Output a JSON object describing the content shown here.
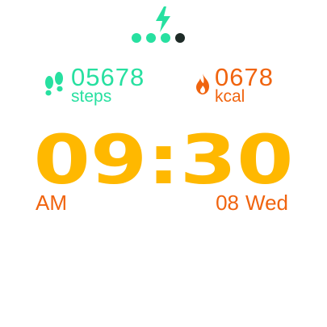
{
  "colors": {
    "accent_green": "#27e0a0",
    "accent_orange": "#f0640f",
    "time_yellow": "#ffb800",
    "background": "#ffffff",
    "dot_inactive": "#1e2b27"
  },
  "battery": {
    "icon": "charging-bolt-icon",
    "level_filled": 3,
    "level_total": 4
  },
  "steps": {
    "icon": "footprints-icon",
    "value": "05678",
    "unit": "steps"
  },
  "calories": {
    "icon": "flame-icon",
    "value": "0678",
    "unit": "kcal"
  },
  "clock": {
    "time": "09:30",
    "period": "AM",
    "day": "08",
    "weekday": "Wed"
  }
}
